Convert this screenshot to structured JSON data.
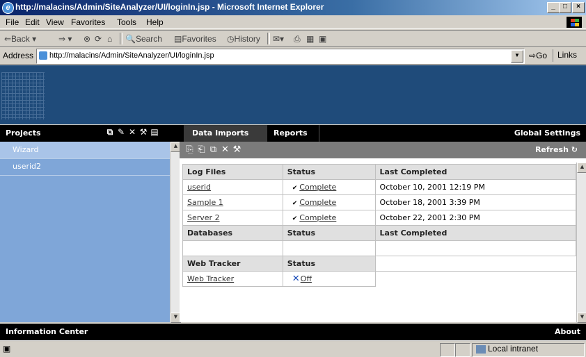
{
  "window": {
    "title": "http://malacins/Admin/SiteAnalyzer/UI/loginIn.jsp - Microsoft Internet Explorer",
    "buttons": [
      "_",
      "□",
      "×"
    ]
  },
  "menu": [
    "File",
    "Edit",
    "View",
    "Favorites",
    "Tools",
    "Help"
  ],
  "toolbar": {
    "back": "⇐Back ▾",
    "forward": "⇒ ▾",
    "search": "Search",
    "favorites": "Favorites",
    "history": "History"
  },
  "address": {
    "label": "Address",
    "url": "http://malacins/Admin/SiteAnalyzer/UI/loginIn.jsp",
    "go": "Go",
    "links": "Links"
  },
  "nav": {
    "projects": "Projects",
    "tabs": [
      "Data Imports",
      "Reports"
    ],
    "global_settings": "Global Settings"
  },
  "projects": [
    "Wizard",
    "userid2"
  ],
  "subtoolbar": {
    "refresh": "Refresh"
  },
  "log_files": {
    "headers": [
      "Log Files",
      "Status",
      "Last Completed"
    ],
    "rows": [
      {
        "name": "userid",
        "status": "Complete",
        "last": "October 10, 2001 12:19 PM"
      },
      {
        "name": "Sample 1",
        "status": "Complete",
        "last": "October 18, 2001 3:39 PM"
      },
      {
        "name": "Server 2",
        "status": "Complete",
        "last": "October 22, 2001 2:30 PM"
      }
    ]
  },
  "databases": {
    "headers": [
      "Databases",
      "Status",
      "Last Completed"
    ]
  },
  "web_tracker": {
    "headers": [
      "Web Tracker",
      "Status"
    ],
    "rows": [
      {
        "name": "Web Tracker",
        "status": "Off"
      }
    ]
  },
  "bottom": {
    "info": "Information Center",
    "about": "About"
  },
  "status": {
    "zone": "Local intranet"
  },
  "colors": {
    "header_blue": "#1f4b7a",
    "project_pane": "#7fa6d8",
    "selected_project": "#a9c4e8",
    "off_icon": "#1a4cb8"
  }
}
